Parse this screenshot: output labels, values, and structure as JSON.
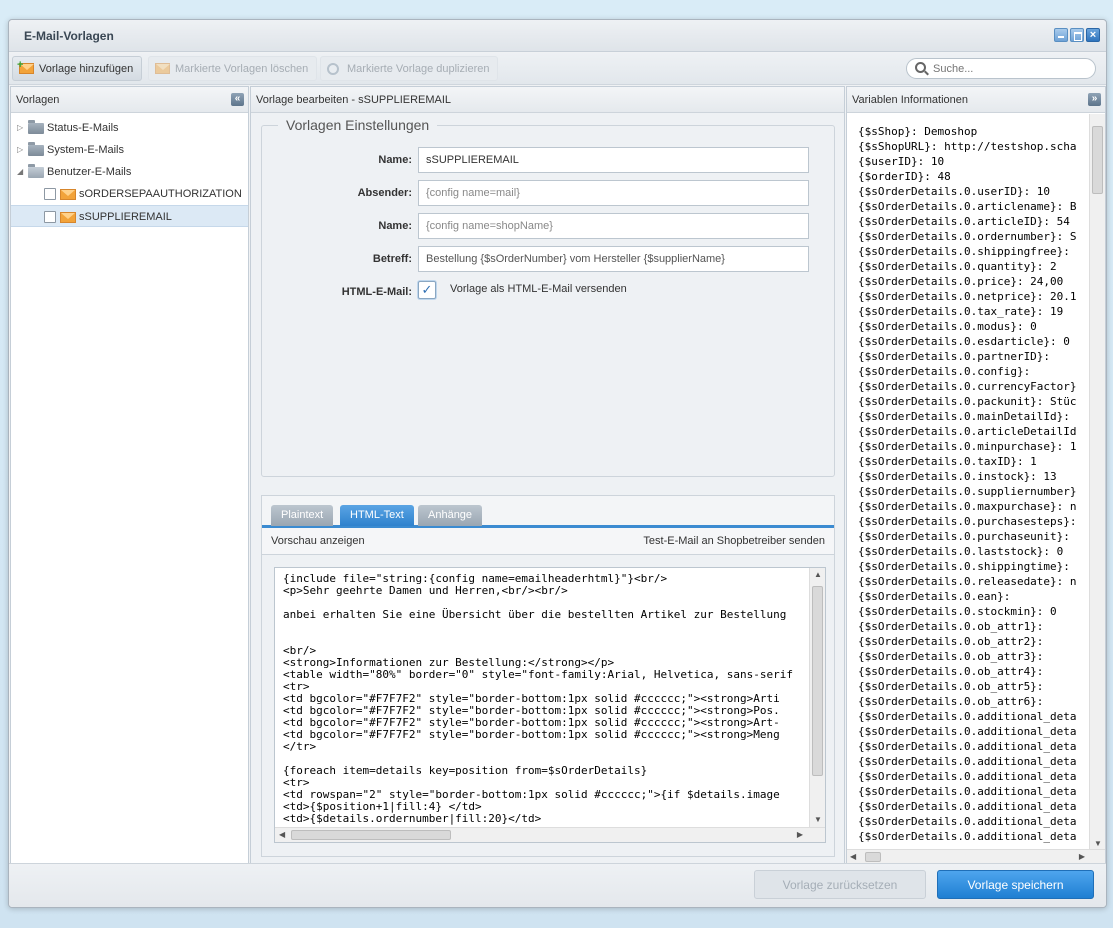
{
  "window": {
    "title": "E-Mail-Vorlagen"
  },
  "toolbar": {
    "add_label": "Vorlage hinzufügen",
    "delete_label": "Markierte Vorlagen löschen",
    "duplicate_label": "Markierte Vorlage duplizieren",
    "search_placeholder": "Suche..."
  },
  "left": {
    "title": "Vorlagen",
    "collapse_glyph": "«",
    "folders": [
      {
        "label": "Status-E-Mails",
        "expanded": false
      },
      {
        "label": "System-E-Mails",
        "expanded": false
      },
      {
        "label": "Benutzer-E-Mails",
        "expanded": true
      }
    ],
    "items": [
      {
        "label": "sORDERSEPAAUTHORIZATION",
        "selected": false
      },
      {
        "label": "sSUPPLIEREMAIL",
        "selected": true
      }
    ]
  },
  "editor": {
    "title": "Vorlage bearbeiten - sSUPPLIEREMAIL",
    "legend": "Vorlagen Einstellungen",
    "fields": [
      {
        "label": "Name:",
        "value": "sSUPPLIEREMAIL"
      },
      {
        "label": "Absender:",
        "value": "{config name=mail}"
      },
      {
        "label": "Name:",
        "value": "{config name=shopName}"
      },
      {
        "label": "Betreff:",
        "value": "Bestellung {$sOrderNumber} vom Hersteller {$supplierName}"
      }
    ],
    "html_label": "HTML-E-Mail:",
    "html_checkbox_label": "Vorlage als HTML-E-Mail versenden",
    "html_checked": true,
    "tabs": [
      "Plaintext",
      "HTML-Text",
      "Anhänge"
    ],
    "active_tab": "HTML-Text",
    "preview_label": "Vorschau anzeigen",
    "test_mail_label": "Test-E-Mail an Shopbetreiber senden",
    "code": "{include file=\"string:{config name=emailheaderhtml}\"}<br/>\n<p>Sehr geehrte Damen und Herren,<br/><br/>\n\nanbei erhalten Sie eine Übersicht über die bestellten Artikel zur Bestellung\n\n\n<br/>\n<strong>Informationen zur Bestellung:</strong></p>\n<table width=\"80%\" border=\"0\" style=\"font-family:Arial, Helvetica, sans-serif\n<tr>\n<td bgcolor=\"#F7F7F2\" style=\"border-bottom:1px solid #cccccc;\"><strong>Arti\n<td bgcolor=\"#F7F7F2\" style=\"border-bottom:1px solid #cccccc;\"><strong>Pos.\n<td bgcolor=\"#F7F7F2\" style=\"border-bottom:1px solid #cccccc;\"><strong>Art-\n<td bgcolor=\"#F7F7F2\" style=\"border-bottom:1px solid #cccccc;\"><strong>Meng\n</tr>\n\n{foreach item=details key=position from=$sOrderDetails}\n<tr>\n<td rowspan=\"2\" style=\"border-bottom:1px solid #cccccc;\">{if $details.image\n<td>{$position+1|fill:4} </td>\n<td>{$details.ordernumber|fill:20}</td>"
  },
  "vars": {
    "title": "Variablen Informationen",
    "collapse_glyph": "»",
    "text": "{$sShop}: Demoshop\n{$sShopURL}: http://testshop.scha\n{$userID}: 10\n{$orderID}: 48\n{$sOrderDetails.0.userID}: 10\n{$sOrderDetails.0.articlename}: B\n{$sOrderDetails.0.articleID}: 54\n{$sOrderDetails.0.ordernumber}: S\n{$sOrderDetails.0.shippingfree}:\n{$sOrderDetails.0.quantity}: 2\n{$sOrderDetails.0.price}: 24,00\n{$sOrderDetails.0.netprice}: 20.1\n{$sOrderDetails.0.tax_rate}: 19\n{$sOrderDetails.0.modus}: 0\n{$sOrderDetails.0.esdarticle}: 0\n{$sOrderDetails.0.partnerID}:\n{$sOrderDetails.0.config}:\n{$sOrderDetails.0.currencyFactor}\n{$sOrderDetails.0.packunit}: Stüc\n{$sOrderDetails.0.mainDetailId}:\n{$sOrderDetails.0.articleDetailId\n{$sOrderDetails.0.minpurchase}: 1\n{$sOrderDetails.0.taxID}: 1\n{$sOrderDetails.0.instock}: 13\n{$sOrderDetails.0.suppliernumber}\n{$sOrderDetails.0.maxpurchase}: n\n{$sOrderDetails.0.purchasesteps}:\n{$sOrderDetails.0.purchaseunit}:\n{$sOrderDetails.0.laststock}: 0\n{$sOrderDetails.0.shippingtime}:\n{$sOrderDetails.0.releasedate}: n\n{$sOrderDetails.0.ean}:\n{$sOrderDetails.0.stockmin}: 0\n{$sOrderDetails.0.ob_attr1}:\n{$sOrderDetails.0.ob_attr2}:\n{$sOrderDetails.0.ob_attr3}:\n{$sOrderDetails.0.ob_attr4}:\n{$sOrderDetails.0.ob_attr5}:\n{$sOrderDetails.0.ob_attr6}:\n{$sOrderDetails.0.additional_deta\n{$sOrderDetails.0.additional_deta\n{$sOrderDetails.0.additional_deta\n{$sOrderDetails.0.additional_deta\n{$sOrderDetails.0.additional_deta\n{$sOrderDetails.0.additional_deta\n{$sOrderDetails.0.additional_deta\n{$sOrderDetails.0.additional_deta\n{$sOrderDetails.0.additional_deta"
  },
  "footer": {
    "reset_label": "Vorlage zurücksetzen",
    "save_label": "Vorlage speichern"
  },
  "colors": {
    "accent": "#2f82cd",
    "save": "#1f7fd2"
  }
}
